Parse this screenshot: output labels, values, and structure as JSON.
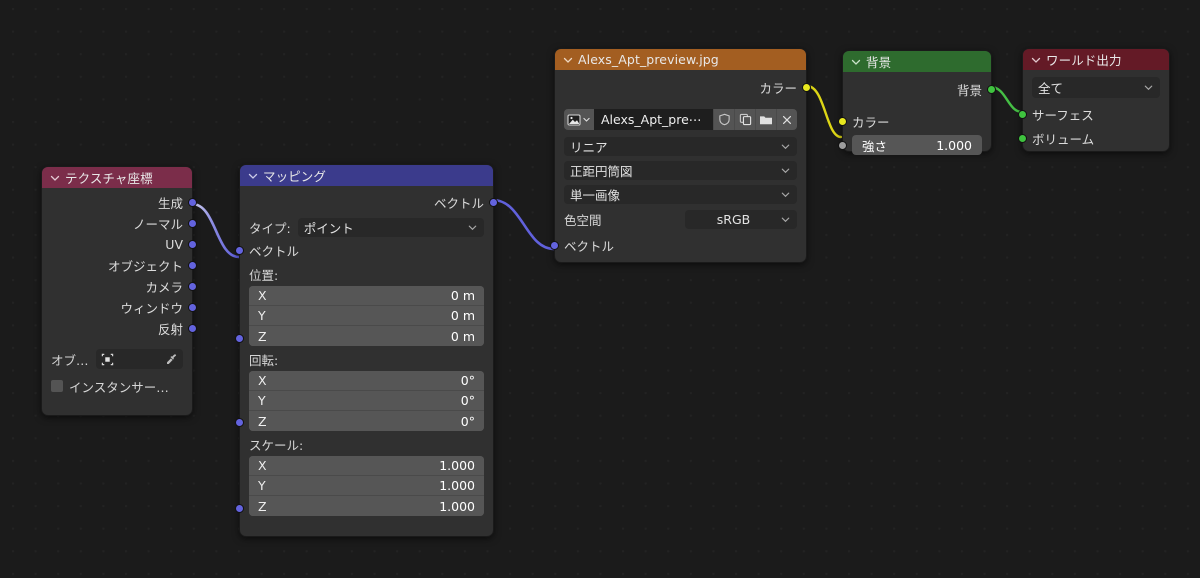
{
  "editor": {
    "name": "blender-shader-node-editor",
    "background_color": "#1b1b1b"
  },
  "nodes": {
    "texture_coordinate": {
      "title": "テクスチャ座標",
      "header_color": "#7b2d4a",
      "outputs": [
        "生成",
        "ノーマル",
        "UV",
        "オブジェクト",
        "カメラ",
        "ウィンドウ",
        "反射"
      ],
      "object_label": "オブ…",
      "instancer_label": "インスタンサー…"
    },
    "mapping": {
      "title": "マッピング",
      "header_color": "#3b3b8c",
      "output_label": "ベクトル",
      "type_label": "タイプ:",
      "type_value": "ポイント",
      "input_label": "ベクトル",
      "location_label": "位置:",
      "location": [
        {
          "axis": "X",
          "value": "0 m"
        },
        {
          "axis": "Y",
          "value": "0 m"
        },
        {
          "axis": "Z",
          "value": "0 m"
        }
      ],
      "rotation_label": "回転:",
      "rotation": [
        {
          "axis": "X",
          "value": "0°"
        },
        {
          "axis": "Y",
          "value": "0°"
        },
        {
          "axis": "Z",
          "value": "0°"
        }
      ],
      "scale_label": "スケール:",
      "scale": [
        {
          "axis": "X",
          "value": "1.000"
        },
        {
          "axis": "Y",
          "value": "1.000"
        },
        {
          "axis": "Z",
          "value": "1.000"
        }
      ]
    },
    "image_texture": {
      "title": "Alexs_Apt_preview.jpg",
      "header_color": "#a35e21",
      "output_label": "カラー",
      "datablock_name": "Alexs_Apt_pre⋯",
      "interpolation": "リニア",
      "projection": "正距円筒図",
      "extension": "単一画像",
      "colorspace_label": "色空間",
      "colorspace_value": "sRGB",
      "input_label": "ベクトル"
    },
    "background": {
      "title": "背景",
      "header_color": "#2e6b2e",
      "output_label": "背景",
      "color_label": "カラー",
      "strength_label": "強さ",
      "strength_value": "1.000"
    },
    "world_output": {
      "title": "ワールド出力",
      "header_color": "#641a26",
      "target_value": "全て",
      "inputs": [
        "サーフェス",
        "ボリューム"
      ]
    }
  },
  "links": [
    {
      "from": "texture_coordinate.生成",
      "to": "mapping.ベクトル",
      "color": "#6363de"
    },
    {
      "from": "mapping.ベクトル",
      "to": "image_texture.ベクトル",
      "color": "#6363de"
    },
    {
      "from": "image_texture.カラー",
      "to": "background.カラー",
      "color": "#e8e81f"
    },
    {
      "from": "background.背景",
      "to": "world_output.サーフェス",
      "color": "#3fc33f"
    }
  ],
  "socket_colors": {
    "vector": "#6363de",
    "color": "#e8e81f",
    "shader": "#3fc33f",
    "value": "#9c9c9c"
  }
}
